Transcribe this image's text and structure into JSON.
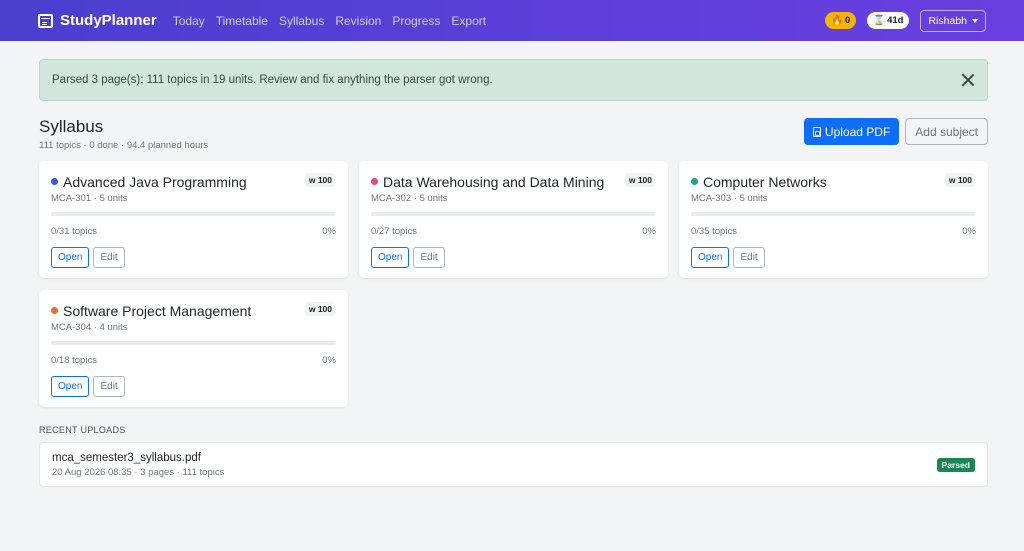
{
  "nav": {
    "brand": "StudyPlanner",
    "links": [
      "Today",
      "Timetable",
      "Syllabus",
      "Revision",
      "Progress",
      "Export"
    ],
    "streak": "0",
    "streak_icon": "flame-icon",
    "countdown": "41d",
    "countdown_icon": "hourglass-icon",
    "user": "Rishabh"
  },
  "alert": {
    "message": "Parsed 3 page(s): 111 topics in 19 units. Review and fix anything the parser got wrong."
  },
  "page": {
    "title": "Syllabus",
    "stats": "111 topics · 0 done · 94.4 planned hours",
    "upload_label": "Upload PDF",
    "add_label": "Add subject"
  },
  "subjects": [
    {
      "name": "Advanced Java Programming",
      "meta": "MCA-301 · 5 units",
      "weight": "w 100",
      "topics": "0/31 topics",
      "percent": "0%",
      "progress": 0,
      "color": "#3b5bdb",
      "open": "Open",
      "edit": "Edit"
    },
    {
      "name": "Data Warehousing and Data Mining",
      "meta": "MCA-302 · 5 units",
      "weight": "w 100",
      "topics": "0/27 topics",
      "percent": "0%",
      "progress": 0,
      "color": "#e64980",
      "open": "Open",
      "edit": "Edit"
    },
    {
      "name": "Computer Networks",
      "meta": "MCA-303 · 5 units",
      "weight": "w 100",
      "topics": "0/35 topics",
      "percent": "0%",
      "progress": 0,
      "color": "#20a08f",
      "open": "Open",
      "edit": "Edit"
    },
    {
      "name": "Software Project Management",
      "meta": "MCA-304 · 4 units",
      "weight": "w 100",
      "topics": "0/18 topics",
      "percent": "0%",
      "progress": 0,
      "color": "#ee6c3b",
      "open": "Open",
      "edit": "Edit"
    }
  ],
  "recent": {
    "label": "RECENT UPLOADS",
    "items": [
      {
        "file": "mca_semester3_syllabus.pdf",
        "meta": "20 Aug 2026 08:35 · 3 pages · 111 topics",
        "status": "Parsed"
      }
    ]
  },
  "colors": {
    "nav_start": "#4a3fce",
    "nav_end": "#6a3fe0",
    "primary": "#0d6efd",
    "alert_bg": "#d1e7dd",
    "success": "#198754",
    "streak": "#f5b400"
  }
}
